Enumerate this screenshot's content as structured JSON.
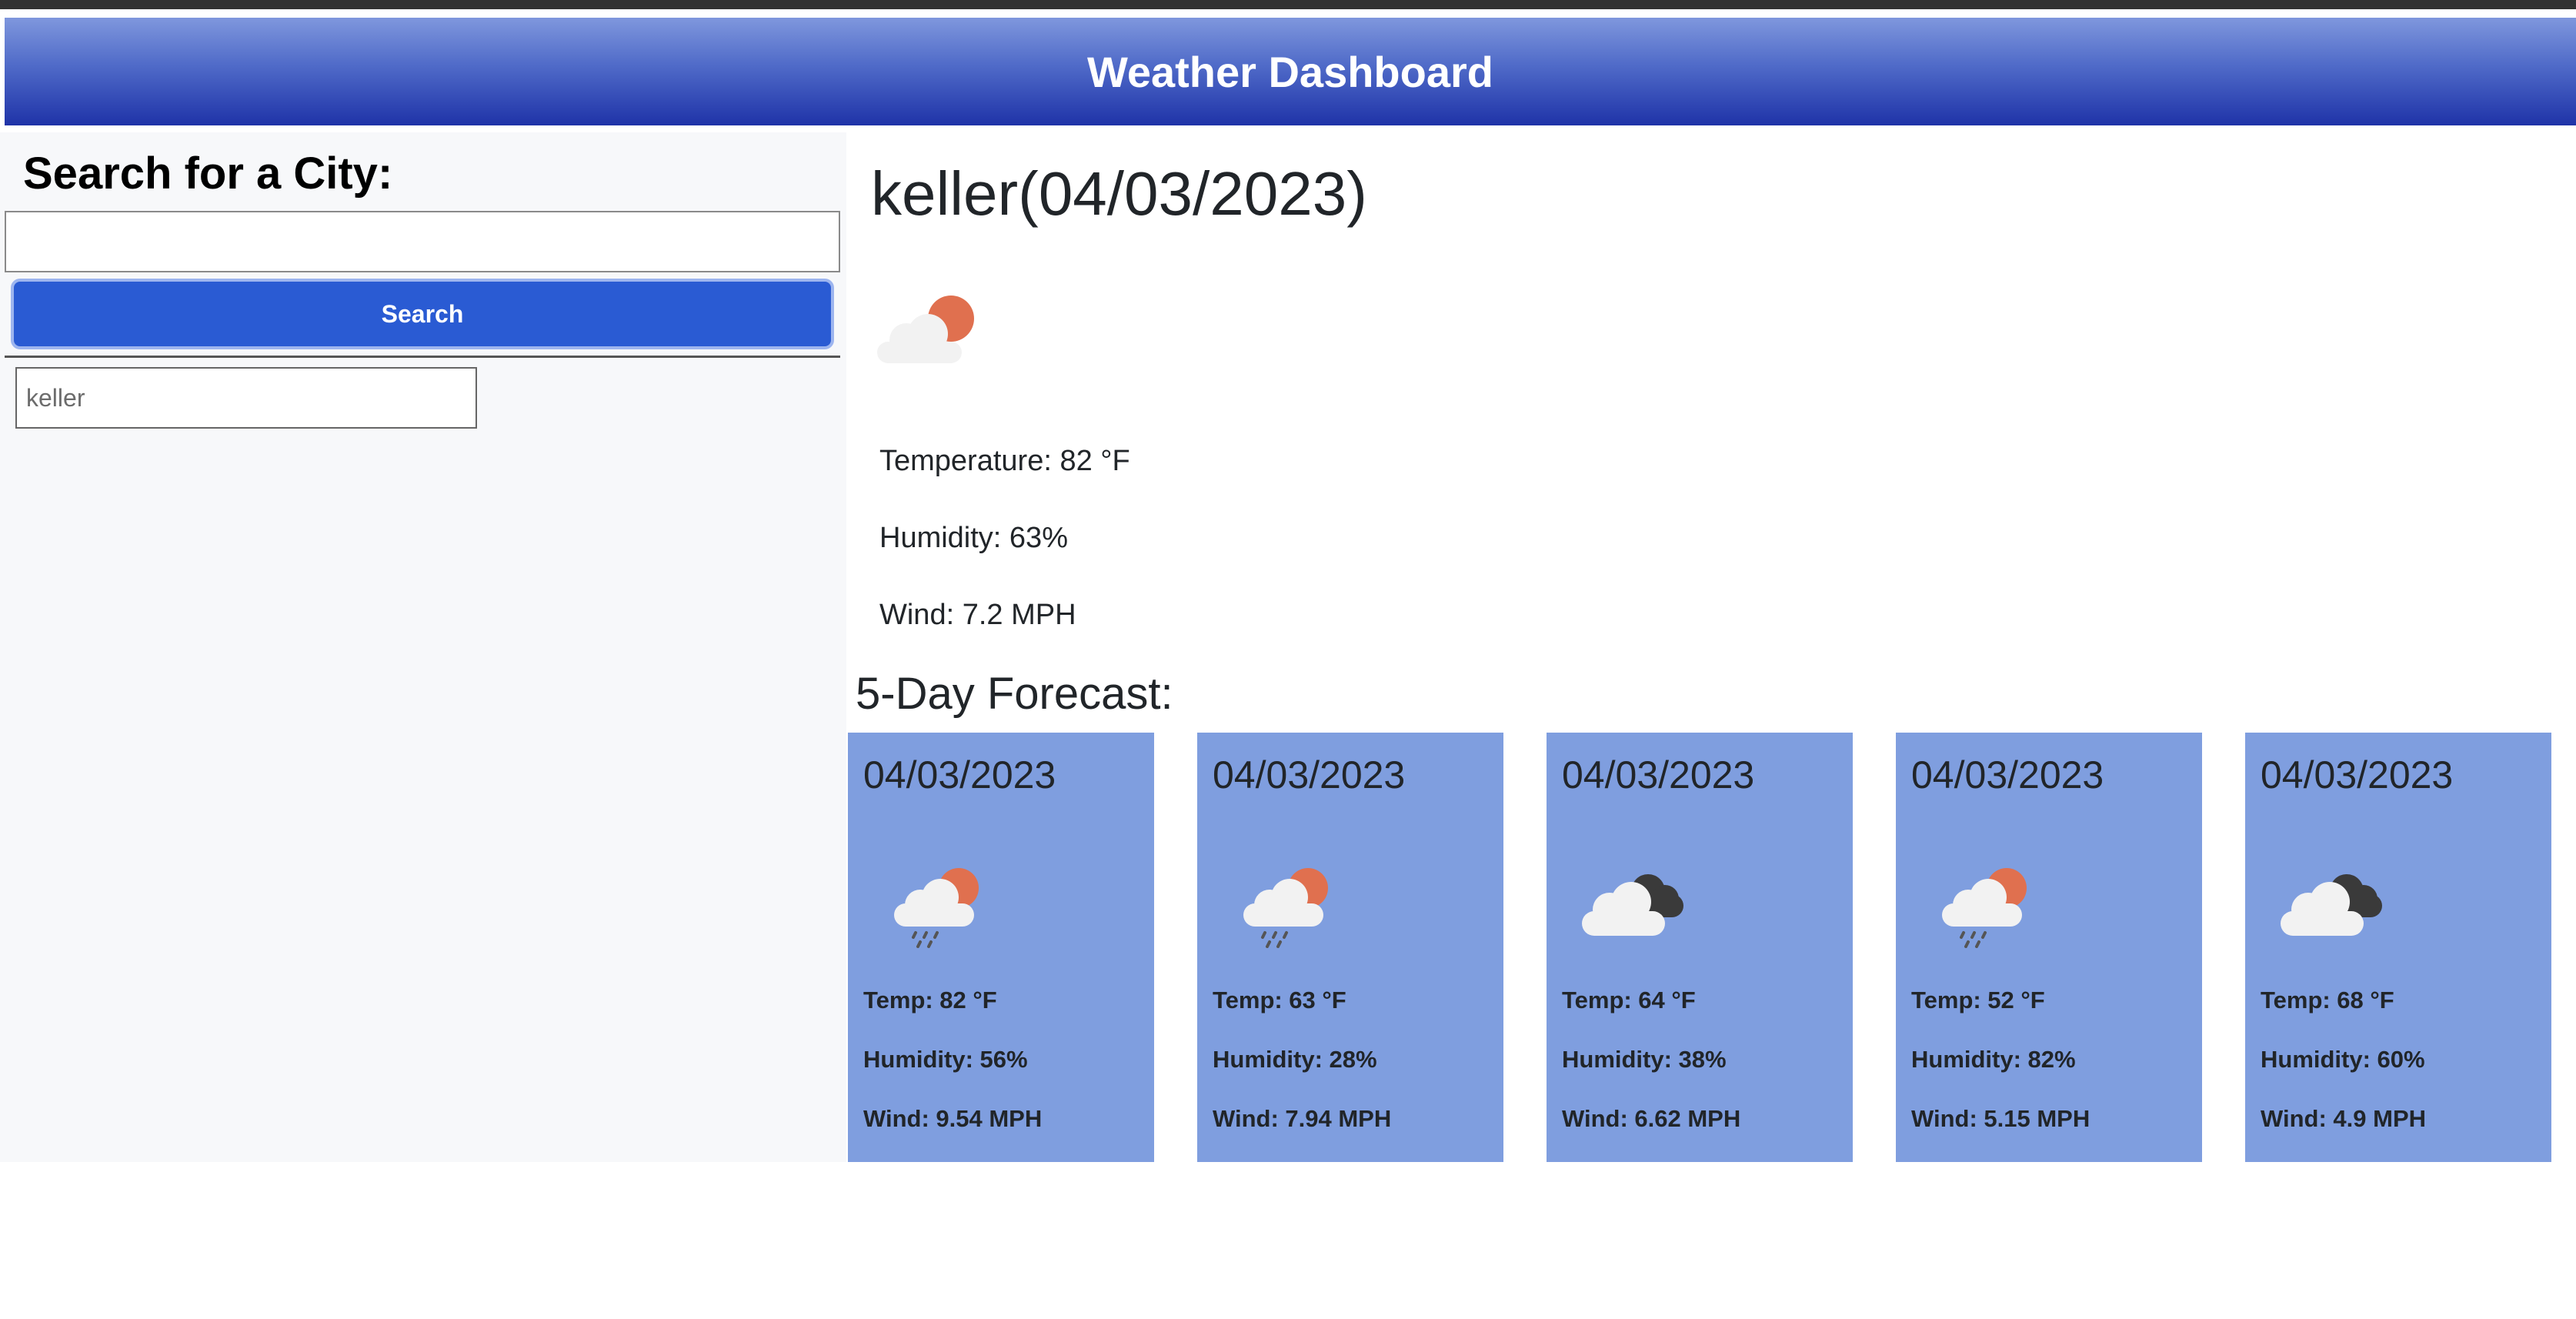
{
  "header": {
    "title": "Weather Dashboard"
  },
  "sidebar": {
    "heading": "Search for a City:",
    "input_value": "",
    "search_label": "Search",
    "history": [
      "keller"
    ]
  },
  "current": {
    "title": "keller(04/03/2023)",
    "icon": "partly-cloudy-icon",
    "temperature": "Temperature: 82 °F",
    "humidity": "Humidity: 63%",
    "wind": "Wind: 7.2 MPH"
  },
  "forecast": {
    "heading": "5-Day Forecast:",
    "days": [
      {
        "date": "04/03/2023",
        "icon": "rain-sun-icon",
        "temp": "Temp: 82 °F",
        "humidity": "Humidity: 56%",
        "wind": "Wind: 9.54 MPH"
      },
      {
        "date": "04/03/2023",
        "icon": "rain-sun-icon",
        "temp": "Temp: 63 °F",
        "humidity": "Humidity: 28%",
        "wind": "Wind: 7.94 MPH"
      },
      {
        "date": "04/03/2023",
        "icon": "dark-cloud-icon",
        "temp": "Temp: 64 °F",
        "humidity": "Humidity: 38%",
        "wind": "Wind: 6.62 MPH"
      },
      {
        "date": "04/03/2023",
        "icon": "rain-sun-icon",
        "temp": "Temp: 52 °F",
        "humidity": "Humidity: 82%",
        "wind": "Wind: 5.15 MPH"
      },
      {
        "date": "04/03/2023",
        "icon": "dark-cloud-icon",
        "temp": "Temp: 68 °F",
        "humidity": "Humidity: 60%",
        "wind": "Wind: 4.9 MPH"
      }
    ]
  },
  "colors": {
    "header_top": "#7f97dd",
    "header_bottom": "#1f33a8",
    "search_button": "#2a5bd3",
    "card_bg": "#7f9edf",
    "sun": "#e0704f"
  }
}
